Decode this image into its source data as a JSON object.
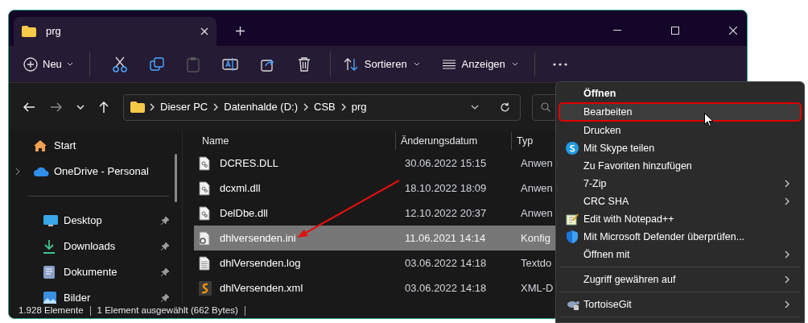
{
  "window": {
    "tab_title": "prg"
  },
  "toolbar": {
    "new_label": "Neu",
    "sort_label": "Sortieren",
    "view_label": "Anzeigen"
  },
  "address": {
    "segments": [
      "Dieser PC",
      "Datenhalde (D:)",
      "CSB",
      "prg"
    ]
  },
  "sidebar": {
    "items": [
      {
        "kind": "item",
        "label": "Start",
        "pinned": false,
        "expandable": false
      },
      {
        "kind": "item",
        "label": "OneDrive - Personal",
        "pinned": false,
        "expandable": true
      },
      {
        "kind": "separator"
      },
      {
        "kind": "item",
        "label": "Desktop",
        "pinned": true,
        "expandable": false
      },
      {
        "kind": "item",
        "label": "Downloads",
        "pinned": true,
        "expandable": false
      },
      {
        "kind": "item",
        "label": "Dokumente",
        "pinned": true,
        "expandable": false
      },
      {
        "kind": "item",
        "label": "Bilder",
        "pinned": true,
        "expandable": false
      }
    ]
  },
  "table": {
    "columns": [
      "Name",
      "Änderungsdatum",
      "Typ"
    ],
    "rows": [
      {
        "name": "DCRES.DLL",
        "date": "30.06.2022 15:15",
        "type": "Anwen",
        "selected": false
      },
      {
        "name": "dcxml.dll",
        "date": "18.10.2022 18:09",
        "type": "Anwen",
        "selected": false
      },
      {
        "name": "DelDbe.dll",
        "date": "12.10.2022 20:37",
        "type": "Anwen",
        "selected": false
      },
      {
        "name": "dhlversenden.ini",
        "date": "11.06.2021 14:14",
        "type": "Konfig",
        "selected": true
      },
      {
        "name": "dhlVersenden.log",
        "date": "03.06.2022 14:18",
        "type": "Textdo",
        "selected": false
      },
      {
        "name": "dhlVersenden.xml",
        "date": "03.06.2022 14:18",
        "type": "XML-D",
        "selected": false
      }
    ]
  },
  "status_bar": {
    "count": "1.928 Elemente",
    "selection": "1 Element ausgewählt (662 Bytes)"
  },
  "context_menu": {
    "items": [
      {
        "kind": "item",
        "label": "Öffnen",
        "submenu": false,
        "default": true,
        "highlighted": false
      },
      {
        "kind": "item",
        "label": "Bearbeiten",
        "submenu": false,
        "default": false,
        "highlighted": true
      },
      {
        "kind": "item",
        "label": "Drucken",
        "submenu": false,
        "default": false,
        "highlighted": false
      },
      {
        "kind": "item",
        "label": "Mit Skype teilen",
        "submenu": false,
        "default": false,
        "highlighted": false
      },
      {
        "kind": "item",
        "label": "Zu Favoriten hinzufügen",
        "submenu": false,
        "default": false,
        "highlighted": false
      },
      {
        "kind": "item",
        "label": "7-Zip",
        "submenu": true,
        "default": false,
        "highlighted": false
      },
      {
        "kind": "item",
        "label": "CRC SHA",
        "submenu": true,
        "default": false,
        "highlighted": false
      },
      {
        "kind": "item",
        "label": "Edit with Notepad++",
        "submenu": false,
        "default": false,
        "highlighted": false
      },
      {
        "kind": "item",
        "label": "Mit Microsoft Defender überprüfen...",
        "submenu": false,
        "default": false,
        "highlighted": false
      },
      {
        "kind": "item",
        "label": "Öffnen mit",
        "submenu": true,
        "default": false,
        "highlighted": false
      },
      {
        "kind": "separator"
      },
      {
        "kind": "item",
        "label": "Zugriff gewähren auf",
        "submenu": true,
        "default": false,
        "highlighted": false
      },
      {
        "kind": "separator"
      },
      {
        "kind": "item",
        "label": "TortoiseGit",
        "submenu": true,
        "default": false,
        "highlighted": false
      },
      {
        "kind": "separator"
      }
    ]
  }
}
